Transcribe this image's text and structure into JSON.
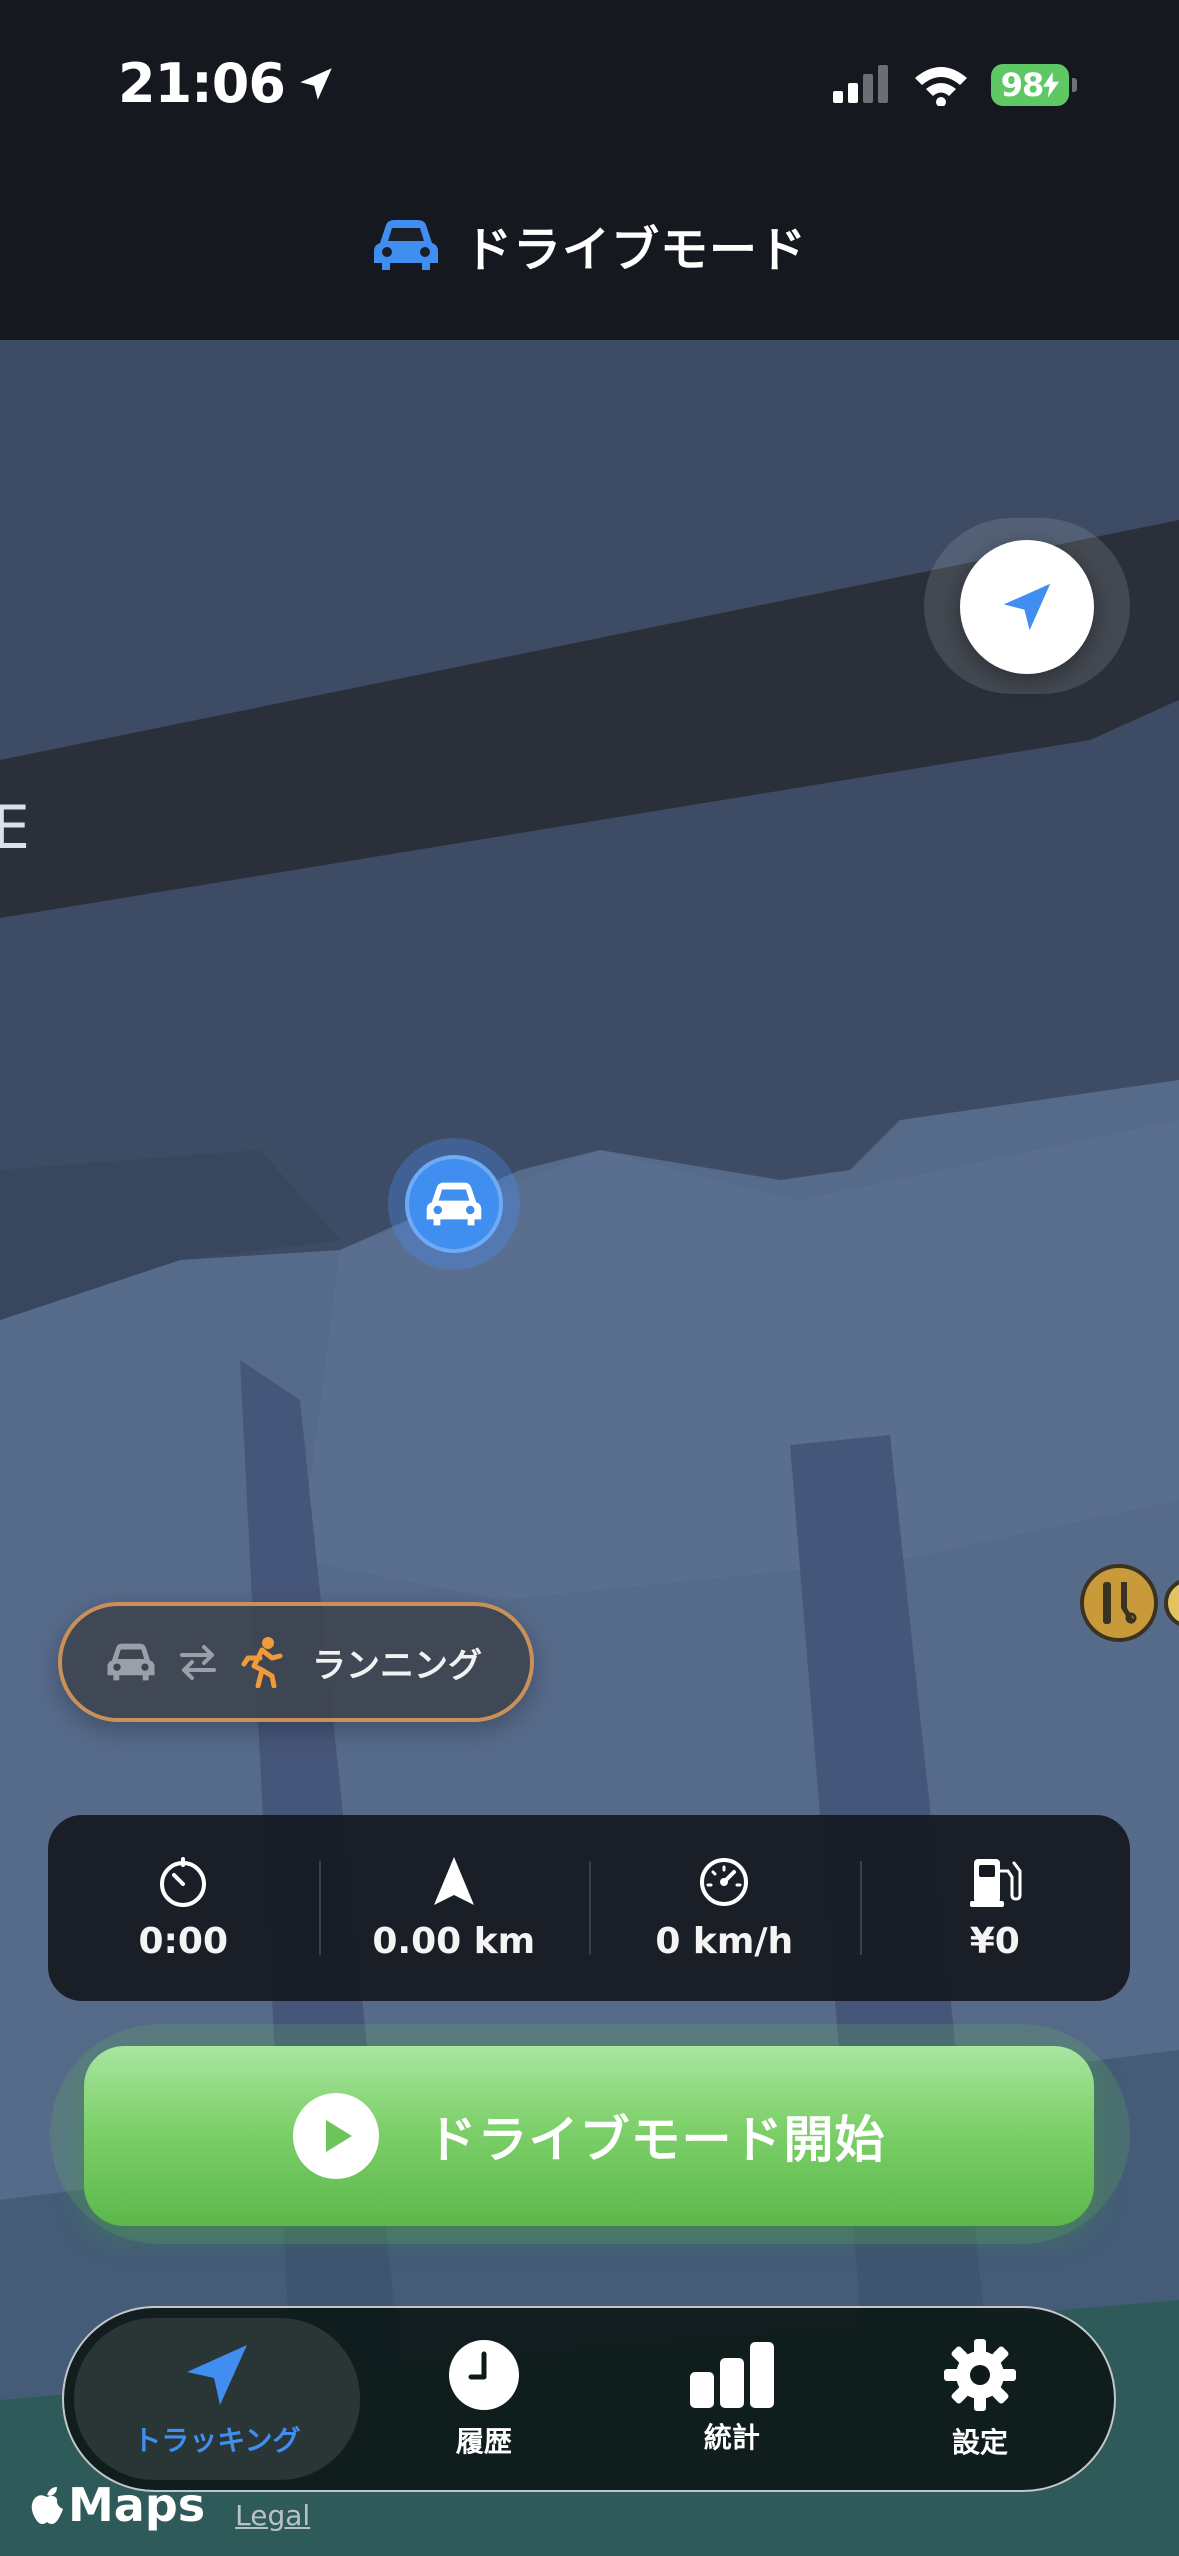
{
  "status_bar": {
    "time": "21:06",
    "battery": "98"
  },
  "header": {
    "title": "ドライブモード",
    "icon": "car-icon"
  },
  "map": {
    "icons": [
      "location-arrow-icon",
      "car-marker-icon",
      "barber-poi-icon"
    ]
  },
  "mode_switch": {
    "label": "ランニング",
    "icons": [
      "car-icon",
      "swap-icon",
      "runner-icon"
    ]
  },
  "stats": [
    {
      "icon": "timer-icon",
      "value": "0:00"
    },
    {
      "icon": "distance-arrow-icon",
      "value": "0.00 km"
    },
    {
      "icon": "speedometer-icon",
      "value": "0 km/h"
    },
    {
      "icon": "fuel-pump-icon",
      "value": "¥0"
    }
  ],
  "start_button": {
    "label": "ドライブモード開始",
    "icon": "play-icon"
  },
  "tabs": [
    {
      "label": "トラッキング",
      "icon": "navigation-arrow-icon",
      "active": true
    },
    {
      "label": "履歴",
      "icon": "clock-icon"
    },
    {
      "label": "統計",
      "icon": "bar-chart-icon"
    },
    {
      "label": "設定",
      "icon": "gear-icon"
    }
  ],
  "attribution": {
    "maps": "Maps",
    "legal": "Legal"
  },
  "colors": {
    "accent": "#3f8ef0",
    "start_green": "#7ed06a",
    "mode_border": "#c9905a",
    "battery": "#5fc864"
  }
}
